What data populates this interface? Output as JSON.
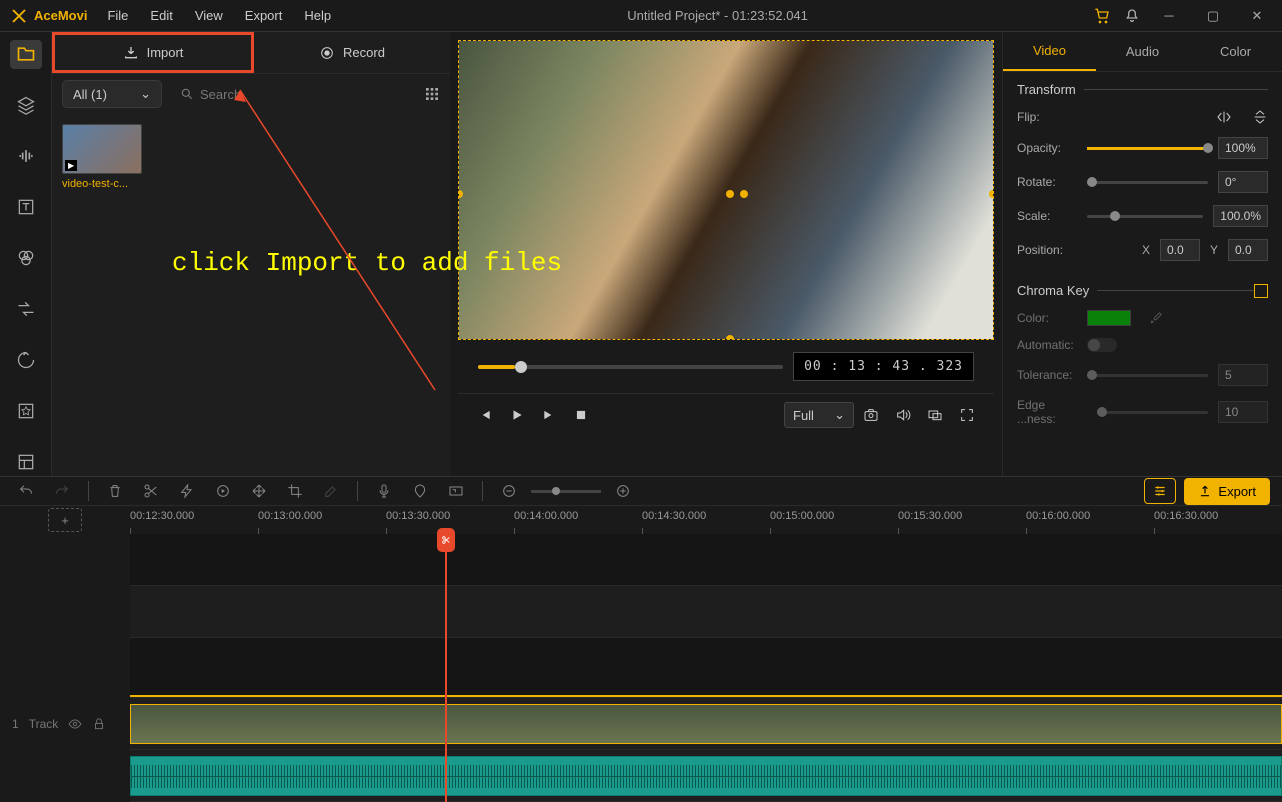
{
  "app": {
    "name": "AceMovi",
    "title": "Untitled Project* - 01:23:52.041"
  },
  "menubar": [
    "File",
    "Edit",
    "View",
    "Export",
    "Help"
  ],
  "media": {
    "import_label": "Import",
    "record_label": "Record",
    "filter": "All (1)",
    "search_placeholder": "Search",
    "thumb_label": "video-test-c..."
  },
  "preview": {
    "timecode": "00 : 13 : 43 . 323",
    "fit_mode": "Full"
  },
  "props": {
    "tabs": [
      "Video",
      "Audio",
      "Color"
    ],
    "s1": "Transform",
    "flip": "Flip:",
    "opacity": {
      "label": "Opacity:",
      "value": "100%"
    },
    "rotate": {
      "label": "Rotate:",
      "value": "0°"
    },
    "scale": {
      "label": "Scale:",
      "value": "100.0%"
    },
    "position": {
      "label": "Position:",
      "xl": "X",
      "x": "0.0",
      "yl": "Y",
      "y": "0.0"
    },
    "s2": "Chroma Key",
    "color": "Color:",
    "automatic": "Automatic:",
    "tolerance": {
      "label": "Tolerance:",
      "value": "5"
    },
    "edge": {
      "label": "Edge ...ness:",
      "value": "10"
    }
  },
  "timeline": {
    "export": "Export",
    "ruler": [
      "00:12:30.000",
      "00:13:00.000",
      "00:13:30.000",
      "00:14:00.000",
      "00:14:30.000",
      "00:15:00.000",
      "00:15:30.000",
      "00:16:00.000",
      "00:16:30.000"
    ],
    "track_id": "1",
    "track_label": "Track"
  },
  "annotation": "click Import to add files"
}
